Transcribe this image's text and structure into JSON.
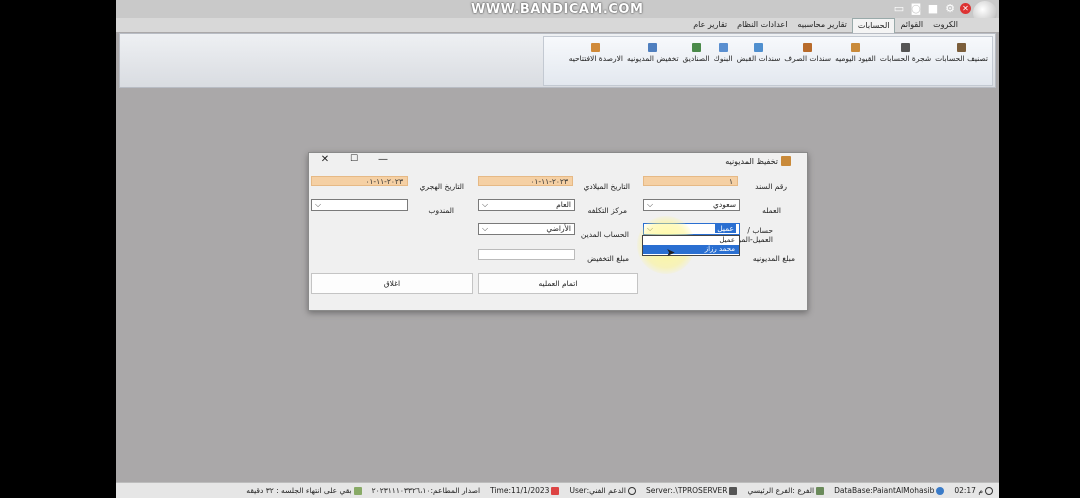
{
  "watermark": "WWW.BANDICAM.COM",
  "titlebar_icons": [
    "close-circle-icon",
    "gear-icon",
    "video-icon",
    "camera-icon",
    "screen-icon"
  ],
  "menubar": {
    "items": [
      {
        "label": "الكروت",
        "active": false
      },
      {
        "label": "القوائم",
        "active": false
      },
      {
        "label": "الحسابات",
        "active": true
      },
      {
        "label": "تقارير محاسبيه",
        "active": false
      },
      {
        "label": "اعدادات النظام",
        "active": false
      },
      {
        "label": "تقارير عام",
        "active": false
      }
    ]
  },
  "ribbon": {
    "buttons": [
      {
        "label": "تصنيف الحسابات",
        "icon": "categories-icon",
        "color": "#7b5e3b"
      },
      {
        "label": "شجرة الحسابات",
        "icon": "tree-icon",
        "color": "#555555"
      },
      {
        "label": "القيود اليوميه",
        "icon": "journal-icon",
        "color": "#c98a3a"
      },
      {
        "label": "سندات الصرف",
        "icon": "payment-voucher-icon",
        "color": "#b86b2b"
      },
      {
        "label": "سندات القبض",
        "icon": "receipt-voucher-icon",
        "color": "#4f8fcf"
      },
      {
        "label": "البنوك",
        "icon": "bank-icon",
        "color": "#5a8fd0"
      },
      {
        "label": "الصناديق",
        "icon": "cashbox-icon",
        "color": "#4a8a4a"
      },
      {
        "label": "تخفيض المديونيه",
        "icon": "debt-reduce-icon",
        "color": "#4f7fbf"
      },
      {
        "label": "الارصدة الافتتاحيه",
        "icon": "opening-balance-icon",
        "color": "#d08a3a"
      }
    ]
  },
  "dialog": {
    "title": "تخفيظ المديونيه",
    "fields": {
      "doc_no_label": "رقم السند",
      "doc_no_value": "١",
      "gregorian_date_label": "التاريخ الميلادي",
      "gregorian_date_value": "٢٠٢٣-١١-٠١",
      "hijri_date_label": "التاريخ الهجري",
      "hijri_date_value": "٢٠٢٣-١١-٠١",
      "currency_label": "العمله",
      "currency_value": "سعودي",
      "cost_center_label": "مركز التكلفه",
      "cost_center_value": "العام",
      "delegate_label": "المندوب",
      "delegate_value": "",
      "account_label": "حساب /العميل-المورد",
      "account_value": "عميل",
      "debtor_account_label": "الحساب المدين",
      "debtor_account_value": "الأراضي",
      "debt_amount_label": "مبلغ المديونيه",
      "discount_amount_label": "مبلغ التخفيض"
    },
    "dropdown_options": [
      {
        "label": "عميل",
        "selected": false
      },
      {
        "label": "محمد رزاز",
        "selected": true
      }
    ],
    "buttons": {
      "complete": "اتمام العمليه",
      "close": "اغلاق"
    }
  },
  "statusbar": {
    "items": [
      {
        "icon": "clock-icon",
        "text": "م 02:17"
      },
      {
        "icon": "database-icon",
        "text": "DataBase:PaiantAlMohasib"
      },
      {
        "icon": "branch-icon",
        "text": "الفرع :الفرع الرئيسي"
      },
      {
        "icon": "server-icon",
        "text": "Server:.\\TPROSERVER"
      },
      {
        "icon": "user-icon",
        "text": "الدعم الفني:User"
      },
      {
        "icon": "calendar-icon",
        "text": "Time:11/1/2023"
      },
      {
        "icon": "",
        "text": "اصدار المطاعم:٢٠٢٣١١١٠٣٣٢٦،١٠"
      },
      {
        "icon": "lock-icon",
        "text": "بقي على انتهاء الجلسه : ٣٢ دقيقه"
      }
    ]
  }
}
